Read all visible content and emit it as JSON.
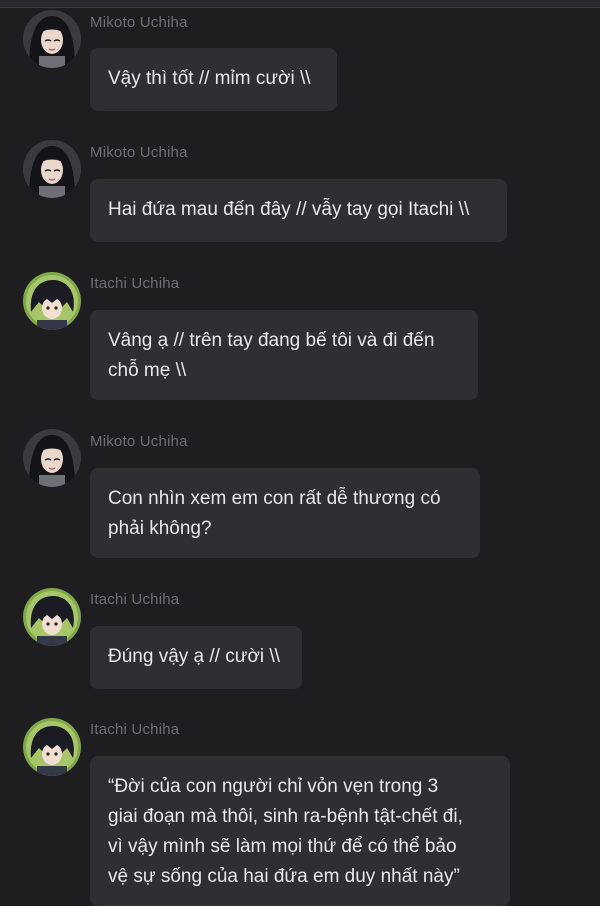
{
  "chat": {
    "messages": [
      {
        "sender": "Mikoto Uchiha",
        "avatar": "mikoto-avatar",
        "lines": [
          "Vậy thì tốt // mỉm cười \\\\"
        ]
      },
      {
        "sender": "Mikoto Uchiha",
        "avatar": "mikoto-avatar",
        "lines": [
          "Hai đứa mau đến đây // vẫy tay gọi Itachi \\\\"
        ]
      },
      {
        "sender": "Itachi Uchiha",
        "avatar": "itachi-avatar",
        "lines": [
          "Vâng ạ // trên tay đang bế tôi và đi đến",
          "chỗ mẹ \\\\"
        ]
      },
      {
        "sender": "Mikoto Uchiha",
        "avatar": "mikoto-avatar",
        "lines": [
          "Con nhìn xem em con rất dễ thương có",
          "phải không?"
        ]
      },
      {
        "sender": "Itachi Uchiha",
        "avatar": "itachi-avatar",
        "lines": [
          "Đúng vậy ạ // cười \\\\"
        ]
      },
      {
        "sender": "Itachi Uchiha",
        "avatar": "itachi-avatar",
        "lines": [
          "“Đời của con người chỉ vỏn vẹn trong 3",
          "giai đoạn mà thôi, sinh ra-bệnh tật-chết đi,",
          "vì vậy mình sẽ làm mọi thứ để có thể bảo",
          "vệ sự sống của hai đứa em duy nhất này”"
        ]
      }
    ]
  },
  "colors": {
    "background": "#1e1e20",
    "bubble": "#2f2f33",
    "text": "#e8e8ea",
    "name": "#6f6f74"
  }
}
